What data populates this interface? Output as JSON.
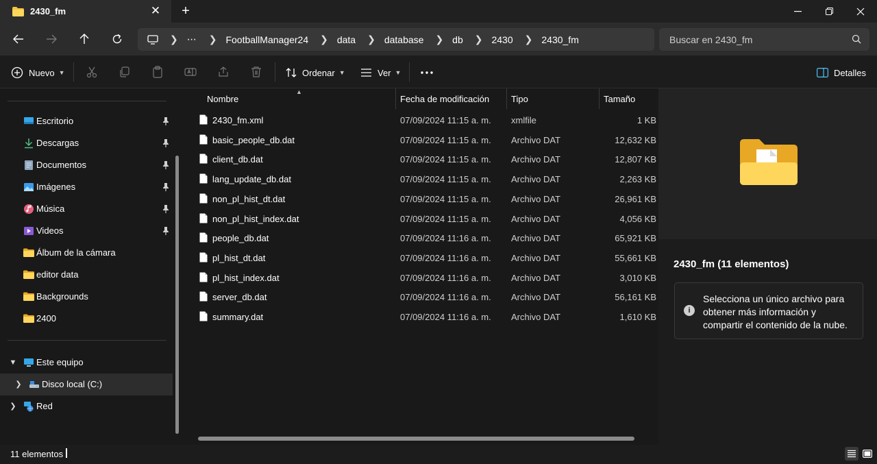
{
  "tab": {
    "title": "2430_fm",
    "icon": "folder-icon"
  },
  "window_controls": {
    "minimize": "minimize-icon",
    "maximize": "restore-icon",
    "close": "close-icon"
  },
  "breadcrumbs": [
    "FootballManager24",
    "data",
    "database",
    "db",
    "2430",
    "2430_fm"
  ],
  "search": {
    "placeholder": "Buscar en 2430_fm"
  },
  "commandbar": {
    "new_label": "Nuevo",
    "sort_label": "Ordenar",
    "view_label": "Ver",
    "details_label": "Detalles"
  },
  "sidebar": {
    "quick_access": [
      {
        "label": "Escritorio",
        "icon": "desktop-icon",
        "pinned": true
      },
      {
        "label": "Descargas",
        "icon": "download-icon",
        "pinned": true
      },
      {
        "label": "Documentos",
        "icon": "document-icon",
        "pinned": true
      },
      {
        "label": "Imágenes",
        "icon": "pictures-icon",
        "pinned": true
      },
      {
        "label": "Música",
        "icon": "music-icon",
        "pinned": true
      },
      {
        "label": "Videos",
        "icon": "videos-icon",
        "pinned": true
      },
      {
        "label": "Álbum de la cámara",
        "icon": "folder-icon",
        "pinned": false
      },
      {
        "label": "editor data",
        "icon": "folder-icon",
        "pinned": false
      },
      {
        "label": "Backgrounds",
        "icon": "folder-icon",
        "pinned": false
      },
      {
        "label": "2400",
        "icon": "folder-icon",
        "pinned": false
      }
    ],
    "this_pc": {
      "label": "Este equipo",
      "icon": "computer-icon"
    },
    "local_disk": {
      "label": "Disco local (C:)",
      "icon": "drive-icon"
    },
    "network": {
      "label": "Red",
      "icon": "network-icon"
    }
  },
  "columns": {
    "name": "Nombre",
    "modified": "Fecha de modificación",
    "type": "Tipo",
    "size": "Tamaño"
  },
  "files": [
    {
      "name": "2430_fm.xml",
      "modified": "07/09/2024 11:15 a. m.",
      "type": "xmlfile",
      "size": "1 KB"
    },
    {
      "name": "basic_people_db.dat",
      "modified": "07/09/2024 11:15 a. m.",
      "type": "Archivo DAT",
      "size": "12,632 KB"
    },
    {
      "name": "client_db.dat",
      "modified": "07/09/2024 11:15 a. m.",
      "type": "Archivo DAT",
      "size": "12,807 KB"
    },
    {
      "name": "lang_update_db.dat",
      "modified": "07/09/2024 11:15 a. m.",
      "type": "Archivo DAT",
      "size": "2,263 KB"
    },
    {
      "name": "non_pl_hist_dt.dat",
      "modified": "07/09/2024 11:15 a. m.",
      "type": "Archivo DAT",
      "size": "26,961 KB"
    },
    {
      "name": "non_pl_hist_index.dat",
      "modified": "07/09/2024 11:15 a. m.",
      "type": "Archivo DAT",
      "size": "4,056 KB"
    },
    {
      "name": "people_db.dat",
      "modified": "07/09/2024 11:16 a. m.",
      "type": "Archivo DAT",
      "size": "65,921 KB"
    },
    {
      "name": "pl_hist_dt.dat",
      "modified": "07/09/2024 11:16 a. m.",
      "type": "Archivo DAT",
      "size": "55,661 KB"
    },
    {
      "name": "pl_hist_index.dat",
      "modified": "07/09/2024 11:16 a. m.",
      "type": "Archivo DAT",
      "size": "3,010 KB"
    },
    {
      "name": "server_db.dat",
      "modified": "07/09/2024 11:16 a. m.",
      "type": "Archivo DAT",
      "size": "56,161 KB"
    },
    {
      "name": "summary.dat",
      "modified": "07/09/2024 11:16 a. m.",
      "type": "Archivo DAT",
      "size": "1,610 KB"
    }
  ],
  "details": {
    "title": "2430_fm (11 elementos)",
    "info": "Selecciona un único archivo para obtener más información y compartir el contenido de la nube."
  },
  "status": {
    "count": "11 elementos"
  },
  "colors": {
    "folder": "#f3c440",
    "accent": "#4cc2ff",
    "background": "#191919"
  }
}
